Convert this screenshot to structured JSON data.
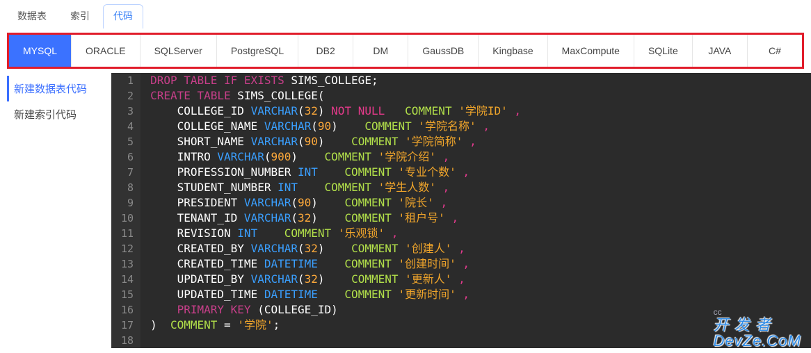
{
  "top_tabs": {
    "items": [
      {
        "label": "数据表",
        "active": false
      },
      {
        "label": "索引",
        "active": false
      },
      {
        "label": "代码",
        "active": true
      }
    ]
  },
  "db_tabs": {
    "items": [
      {
        "label": "MYSQL",
        "active": true
      },
      {
        "label": "ORACLE",
        "active": false
      },
      {
        "label": "SQLServer",
        "active": false
      },
      {
        "label": "PostgreSQL",
        "active": false
      },
      {
        "label": "DB2",
        "active": false
      },
      {
        "label": "DM",
        "active": false
      },
      {
        "label": "GaussDB",
        "active": false
      },
      {
        "label": "Kingbase",
        "active": false
      },
      {
        "label": "MaxCompute",
        "active": false
      },
      {
        "label": "SQLite",
        "active": false
      },
      {
        "label": "JAVA",
        "active": false
      },
      {
        "label": "C#",
        "active": false
      }
    ]
  },
  "sidebar": {
    "items": [
      {
        "label": "新建数据表代码",
        "active": true
      },
      {
        "label": "新建索引代码",
        "active": false
      }
    ]
  },
  "editor": {
    "lines": [
      [
        {
          "t": "DROP TABLE IF EXISTS",
          "c": "kw"
        },
        {
          "t": " SIMS_COLLEGE;",
          "c": "ident"
        }
      ],
      [
        {
          "t": "CREATE TABLE",
          "c": "kw"
        },
        {
          "t": " SIMS_COLLEGE(",
          "c": "ident"
        }
      ],
      [
        {
          "t": "    COLLEGE_ID ",
          "c": "ident"
        },
        {
          "t": "VARCHAR",
          "c": "type"
        },
        {
          "t": "(",
          "c": "paren"
        },
        {
          "t": "32",
          "c": "num"
        },
        {
          "t": ") ",
          "c": "paren"
        },
        {
          "t": "NOT NULL",
          "c": "kw2"
        },
        {
          "t": "   ",
          "c": "ident"
        },
        {
          "t": "COMMENT",
          "c": "cmt"
        },
        {
          "t": " ",
          "c": "ident"
        },
        {
          "t": "'学院ID'",
          "c": "str"
        },
        {
          "t": " ",
          "c": "ident"
        },
        {
          "t": ",",
          "c": "comma2"
        }
      ],
      [
        {
          "t": "    COLLEGE_NAME ",
          "c": "ident"
        },
        {
          "t": "VARCHAR",
          "c": "type"
        },
        {
          "t": "(",
          "c": "paren"
        },
        {
          "t": "90",
          "c": "num"
        },
        {
          "t": ")    ",
          "c": "paren"
        },
        {
          "t": "COMMENT",
          "c": "cmt"
        },
        {
          "t": " ",
          "c": "ident"
        },
        {
          "t": "'学院名称'",
          "c": "str"
        },
        {
          "t": " ",
          "c": "ident"
        },
        {
          "t": ",",
          "c": "comma2"
        }
      ],
      [
        {
          "t": "    SHORT_NAME ",
          "c": "ident"
        },
        {
          "t": "VARCHAR",
          "c": "type"
        },
        {
          "t": "(",
          "c": "paren"
        },
        {
          "t": "90",
          "c": "num"
        },
        {
          "t": ")    ",
          "c": "paren"
        },
        {
          "t": "COMMENT",
          "c": "cmt"
        },
        {
          "t": " ",
          "c": "ident"
        },
        {
          "t": "'学院简称'",
          "c": "str"
        },
        {
          "t": " ",
          "c": "ident"
        },
        {
          "t": ",",
          "c": "comma2"
        }
      ],
      [
        {
          "t": "    INTRO ",
          "c": "ident"
        },
        {
          "t": "VARCHAR",
          "c": "type"
        },
        {
          "t": "(",
          "c": "paren"
        },
        {
          "t": "900",
          "c": "num"
        },
        {
          "t": ")    ",
          "c": "paren"
        },
        {
          "t": "COMMENT",
          "c": "cmt"
        },
        {
          "t": " ",
          "c": "ident"
        },
        {
          "t": "'学院介绍'",
          "c": "str"
        },
        {
          "t": " ",
          "c": "ident"
        },
        {
          "t": ",",
          "c": "comma2"
        }
      ],
      [
        {
          "t": "    PROFESSION_NUMBER ",
          "c": "ident"
        },
        {
          "t": "INT",
          "c": "type"
        },
        {
          "t": "    ",
          "c": "ident"
        },
        {
          "t": "COMMENT",
          "c": "cmt"
        },
        {
          "t": " ",
          "c": "ident"
        },
        {
          "t": "'专业个数'",
          "c": "str"
        },
        {
          "t": " ",
          "c": "ident"
        },
        {
          "t": ",",
          "c": "comma2"
        }
      ],
      [
        {
          "t": "    STUDENT_NUMBER ",
          "c": "ident"
        },
        {
          "t": "INT",
          "c": "type"
        },
        {
          "t": "    ",
          "c": "ident"
        },
        {
          "t": "COMMENT",
          "c": "cmt"
        },
        {
          "t": " ",
          "c": "ident"
        },
        {
          "t": "'学生人数'",
          "c": "str"
        },
        {
          "t": " ",
          "c": "ident"
        },
        {
          "t": ",",
          "c": "comma2"
        }
      ],
      [
        {
          "t": "    PRESIDENT ",
          "c": "ident"
        },
        {
          "t": "VARCHAR",
          "c": "type"
        },
        {
          "t": "(",
          "c": "paren"
        },
        {
          "t": "90",
          "c": "num"
        },
        {
          "t": ")    ",
          "c": "paren"
        },
        {
          "t": "COMMENT",
          "c": "cmt"
        },
        {
          "t": " ",
          "c": "ident"
        },
        {
          "t": "'院长'",
          "c": "str"
        },
        {
          "t": " ",
          "c": "ident"
        },
        {
          "t": ",",
          "c": "comma2"
        }
      ],
      [
        {
          "t": "    TENANT_ID ",
          "c": "ident"
        },
        {
          "t": "VARCHAR",
          "c": "type"
        },
        {
          "t": "(",
          "c": "paren"
        },
        {
          "t": "32",
          "c": "num"
        },
        {
          "t": ")    ",
          "c": "paren"
        },
        {
          "t": "COMMENT",
          "c": "cmt"
        },
        {
          "t": " ",
          "c": "ident"
        },
        {
          "t": "'租户号'",
          "c": "str"
        },
        {
          "t": " ",
          "c": "ident"
        },
        {
          "t": ",",
          "c": "comma2"
        }
      ],
      [
        {
          "t": "    REVISION ",
          "c": "ident"
        },
        {
          "t": "INT",
          "c": "type"
        },
        {
          "t": "    ",
          "c": "ident"
        },
        {
          "t": "COMMENT",
          "c": "cmt"
        },
        {
          "t": " ",
          "c": "ident"
        },
        {
          "t": "'乐观锁'",
          "c": "str"
        },
        {
          "t": " ",
          "c": "ident"
        },
        {
          "t": ",",
          "c": "comma2"
        }
      ],
      [
        {
          "t": "    CREATED_BY ",
          "c": "ident"
        },
        {
          "t": "VARCHAR",
          "c": "type"
        },
        {
          "t": "(",
          "c": "paren"
        },
        {
          "t": "32",
          "c": "num"
        },
        {
          "t": ")    ",
          "c": "paren"
        },
        {
          "t": "COMMENT",
          "c": "cmt"
        },
        {
          "t": " ",
          "c": "ident"
        },
        {
          "t": "'创建人'",
          "c": "str"
        },
        {
          "t": " ",
          "c": "ident"
        },
        {
          "t": ",",
          "c": "comma2"
        }
      ],
      [
        {
          "t": "    CREATED_TIME ",
          "c": "ident"
        },
        {
          "t": "DATETIME",
          "c": "type"
        },
        {
          "t": "    ",
          "c": "ident"
        },
        {
          "t": "COMMENT",
          "c": "cmt"
        },
        {
          "t": " ",
          "c": "ident"
        },
        {
          "t": "'创建时间'",
          "c": "str"
        },
        {
          "t": " ",
          "c": "ident"
        },
        {
          "t": ",",
          "c": "comma2"
        }
      ],
      [
        {
          "t": "    UPDATED_BY ",
          "c": "ident"
        },
        {
          "t": "VARCHAR",
          "c": "type"
        },
        {
          "t": "(",
          "c": "paren"
        },
        {
          "t": "32",
          "c": "num"
        },
        {
          "t": ")    ",
          "c": "paren"
        },
        {
          "t": "COMMENT",
          "c": "cmt"
        },
        {
          "t": " ",
          "c": "ident"
        },
        {
          "t": "'更新人'",
          "c": "str"
        },
        {
          "t": " ",
          "c": "ident"
        },
        {
          "t": ",",
          "c": "comma2"
        }
      ],
      [
        {
          "t": "    UPDATED_TIME ",
          "c": "ident"
        },
        {
          "t": "DATETIME",
          "c": "type"
        },
        {
          "t": "    ",
          "c": "ident"
        },
        {
          "t": "COMMENT",
          "c": "cmt"
        },
        {
          "t": " ",
          "c": "ident"
        },
        {
          "t": "'更新时间'",
          "c": "str"
        },
        {
          "t": " ",
          "c": "ident"
        },
        {
          "t": ",",
          "c": "comma2"
        }
      ],
      [
        {
          "t": "    ",
          "c": "ident"
        },
        {
          "t": "PRIMARY KEY",
          "c": "kw"
        },
        {
          "t": " (COLLEGE_ID)",
          "c": "ident"
        }
      ],
      [
        {
          "t": ")  ",
          "c": "paren"
        },
        {
          "t": "COMMENT",
          "c": "cmt"
        },
        {
          "t": " = ",
          "c": "ident"
        },
        {
          "t": "'学院'",
          "c": "str"
        },
        {
          "t": ";",
          "c": "ident"
        }
      ],
      []
    ]
  },
  "watermark": {
    "line1": "开 发 者",
    "line2": "DevZe.CoM",
    "small": "cc"
  }
}
